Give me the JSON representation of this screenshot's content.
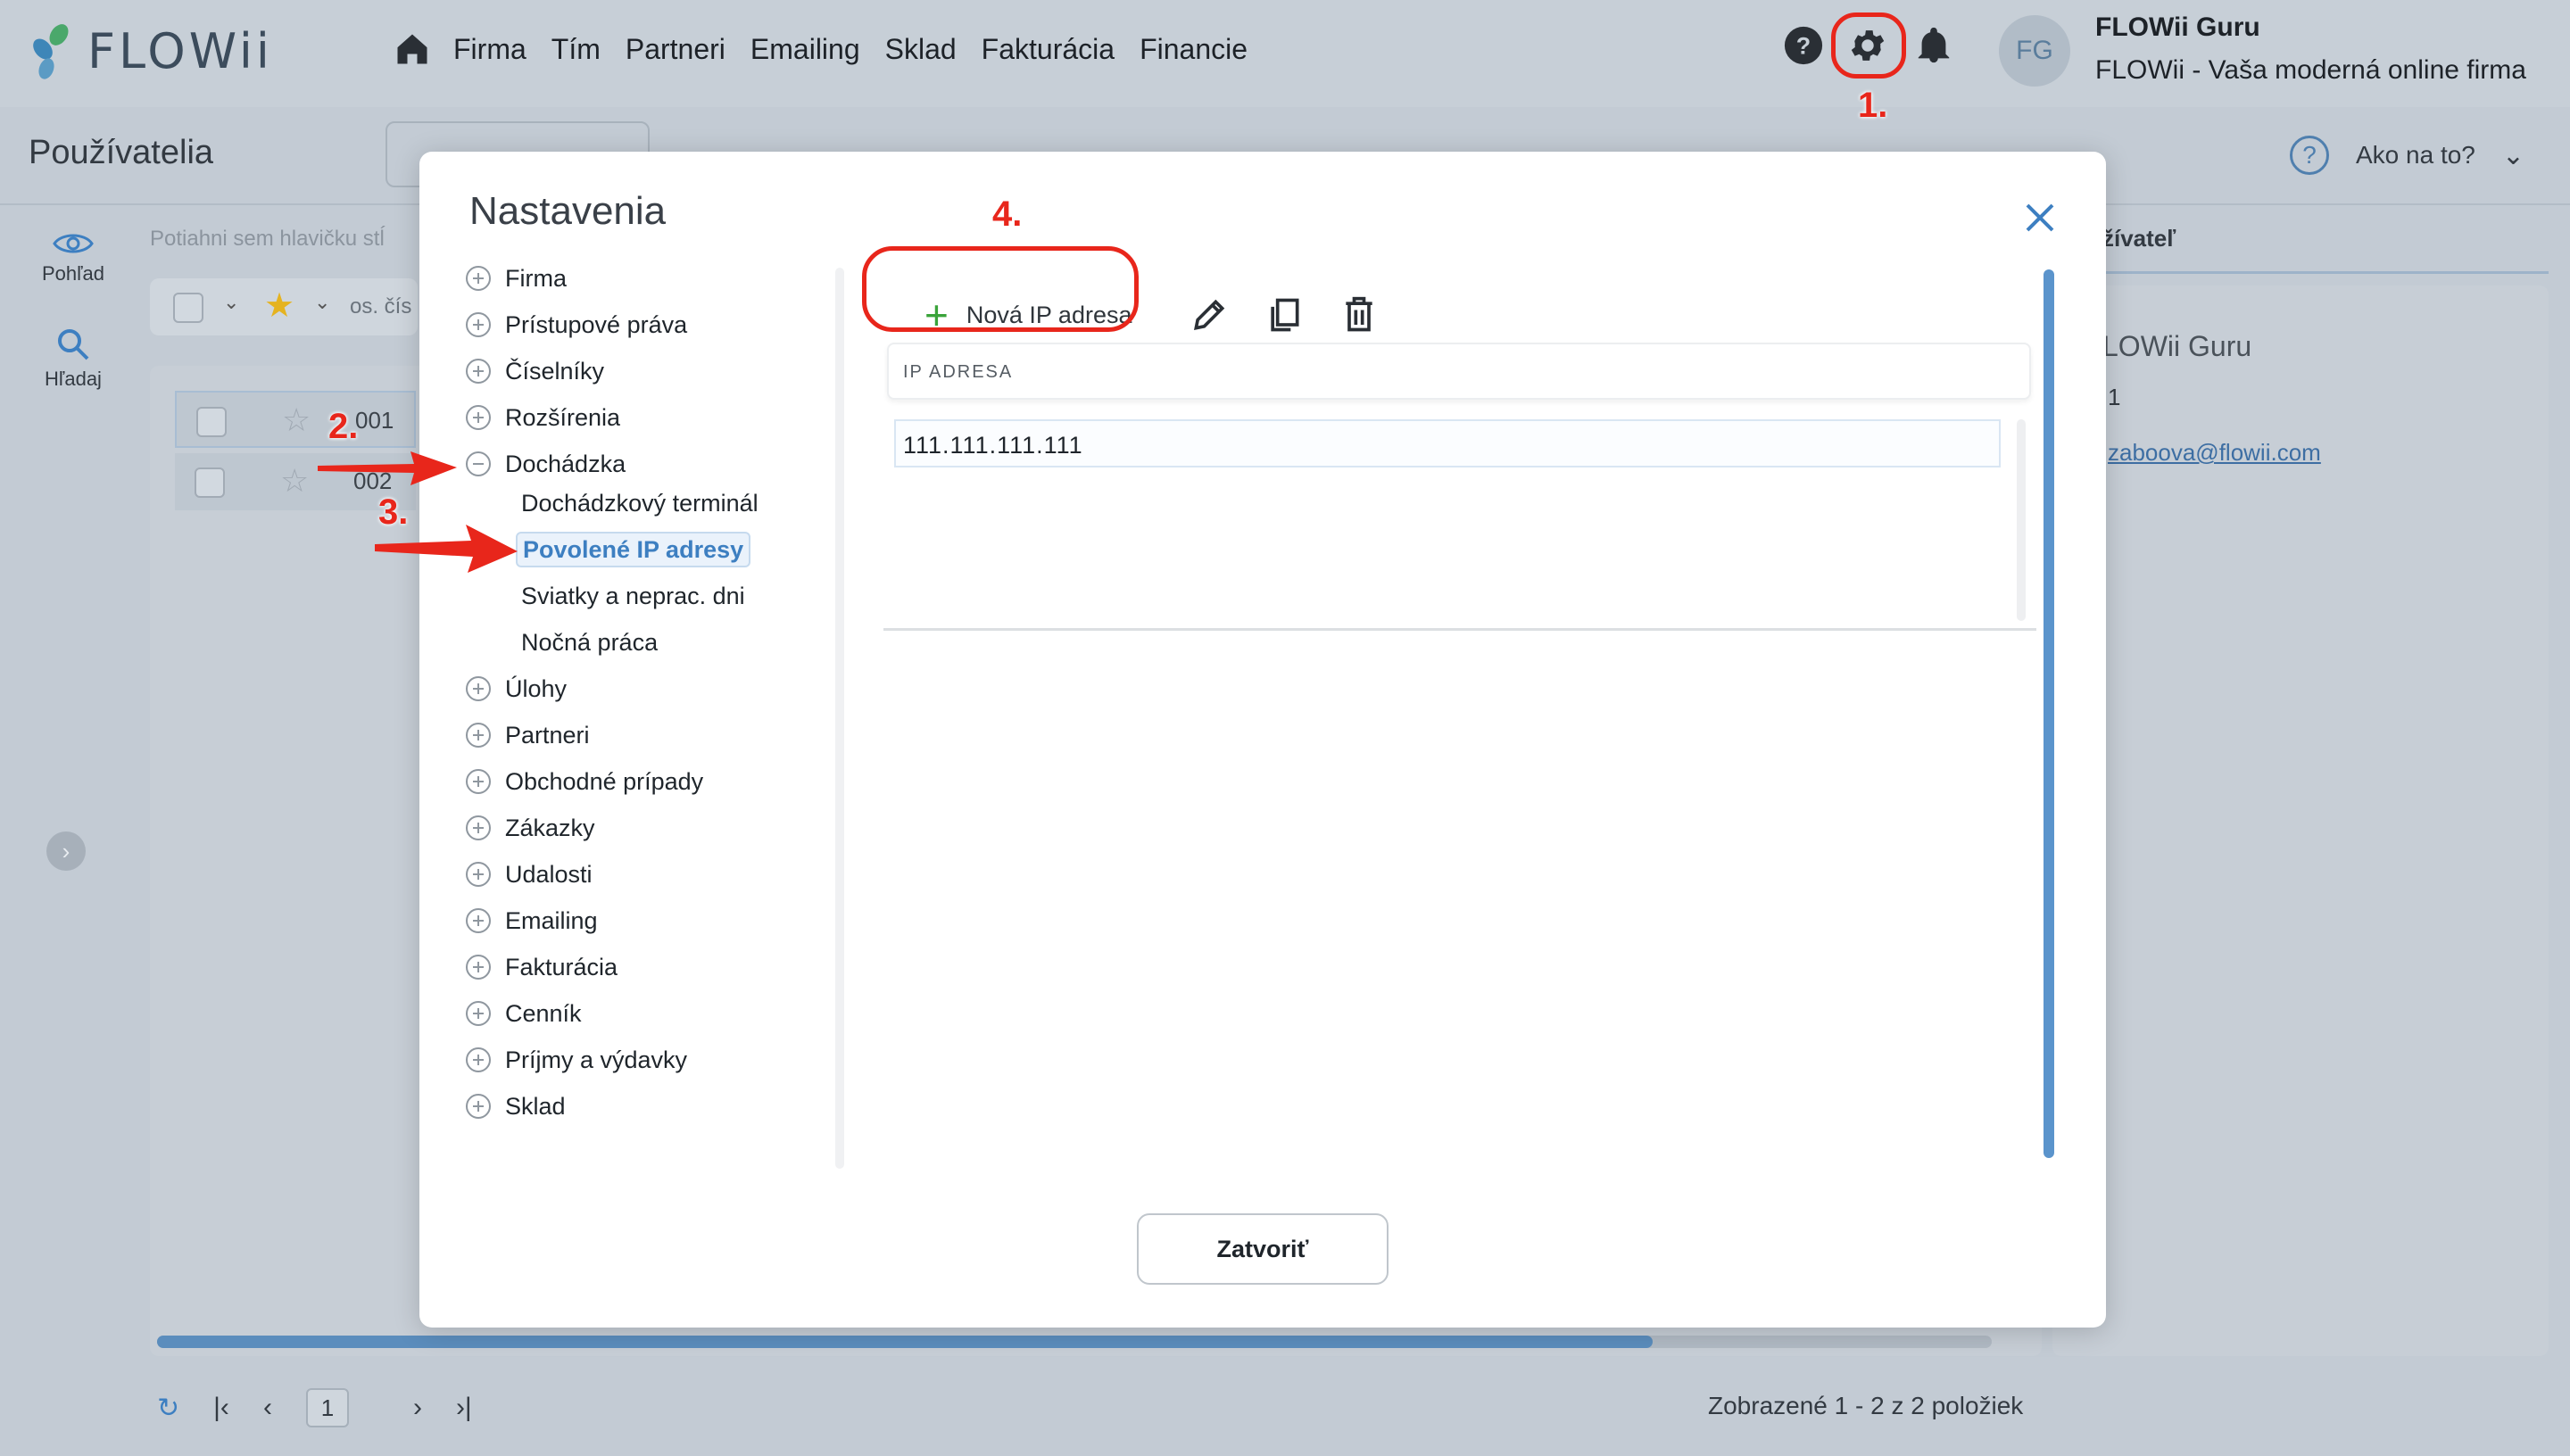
{
  "app": {
    "logo_text": "FLOWii",
    "nav": [
      "Firma",
      "Tím",
      "Partneri",
      "Emailing",
      "Sklad",
      "Fakturácia",
      "Financie"
    ],
    "user_initials": "FG",
    "user_name": "FLOWii Guru",
    "user_company": "FLOWii - Vaša moderná online firma"
  },
  "page": {
    "title": "Používatelia",
    "help_text": "Ako na to?",
    "rail": [
      {
        "label": "Pohľad",
        "icon": "eye-icon"
      },
      {
        "label": "Hľadaj",
        "icon": "search-icon"
      }
    ],
    "drag_hint": "Potiahni sem hlavičku stĺ",
    "filter_col": "os. čís",
    "rows": [
      "001",
      "002"
    ],
    "pager_page": "1",
    "pager_info": "Zobrazené 1 - 2 z 2 položiek",
    "detail": {
      "tab": "žívateľ",
      "name": "LOWii Guru",
      "number": "1",
      "email": "zaboova@flowii.com"
    }
  },
  "modal": {
    "title": "Nastavenia",
    "tree": [
      {
        "label": "Firma",
        "expanded": false
      },
      {
        "label": "Prístupové práva",
        "expanded": false
      },
      {
        "label": "Číselníky",
        "expanded": false
      },
      {
        "label": "Rozšírenia",
        "expanded": false
      },
      {
        "label": "Dochádzka",
        "expanded": true,
        "children": [
          "Dochádzkový terminál",
          "Povolené IP adresy",
          "Sviatky a neprac. dni",
          "Nočná práca"
        ]
      },
      {
        "label": "Úlohy",
        "expanded": false
      },
      {
        "label": "Partneri",
        "expanded": false
      },
      {
        "label": "Obchodné prípady",
        "expanded": false
      },
      {
        "label": "Zákazky",
        "expanded": false
      },
      {
        "label": "Udalosti",
        "expanded": false
      },
      {
        "label": "Emailing",
        "expanded": false
      },
      {
        "label": "Fakturácia",
        "expanded": false
      },
      {
        "label": "Cenník",
        "expanded": false
      },
      {
        "label": "Príjmy a výdavky",
        "expanded": false
      },
      {
        "label": "Sklad",
        "expanded": false
      }
    ],
    "active_child": "Povolené IP adresy",
    "new_ip_label": "Nová IP adresa",
    "grid_header": "IP ADRESA",
    "ip_rows": [
      "111.111.111.111"
    ],
    "close_label": "Zatvoriť"
  },
  "annotations": [
    "1.",
    "2.",
    "3.",
    "4."
  ],
  "colors": {
    "accent": "#3d7fc1",
    "annotation": "#e8261b",
    "add": "#3aa33a"
  }
}
